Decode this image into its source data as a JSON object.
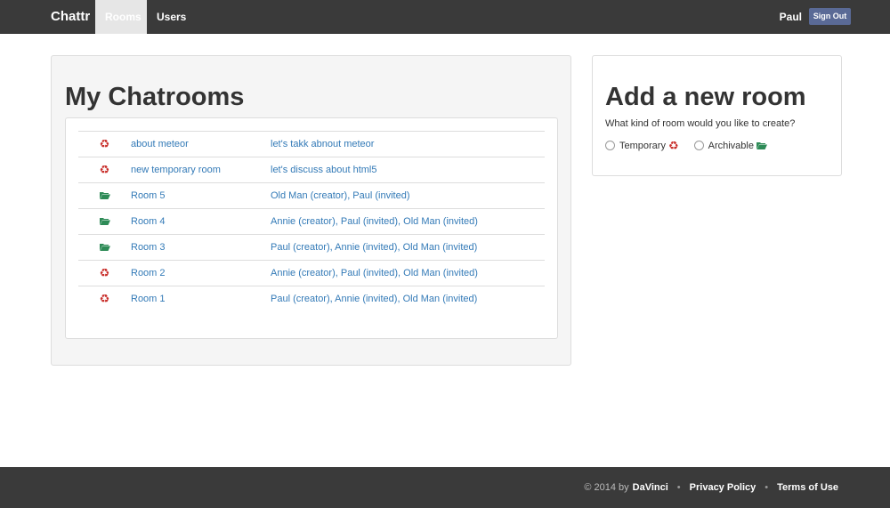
{
  "navbar": {
    "brand": "Chattr",
    "items": [
      {
        "label": "Rooms",
        "active": true
      },
      {
        "label": "Users",
        "active": false
      }
    ],
    "user_name": "Paul",
    "signout_label": "Sign Out"
  },
  "main": {
    "title": "My Chatrooms",
    "rooms": [
      {
        "icon": "recycle-icon",
        "name": "about meteor",
        "description": "let's takk abnout meteor"
      },
      {
        "icon": "recycle-icon",
        "name": "new temporary room",
        "description": "let's discuss about html5"
      },
      {
        "icon": "folder-open-icon",
        "name": "Room 5",
        "description": "Old Man (creator), Paul (invited)"
      },
      {
        "icon": "folder-open-icon",
        "name": "Room 4",
        "description": "Annie (creator), Paul (invited), Old Man (invited)"
      },
      {
        "icon": "folder-open-icon",
        "name": "Room 3",
        "description": "Paul (creator), Annie (invited), Old Man (invited)"
      },
      {
        "icon": "recycle-icon",
        "name": "Room 2",
        "description": "Annie (creator), Paul (invited), Old Man (invited)"
      },
      {
        "icon": "recycle-icon",
        "name": "Room 1",
        "description": "Paul (creator), Annie (invited), Old Man (invited)"
      }
    ]
  },
  "sidebar": {
    "title": "Add a new room",
    "question": "What kind of room would you like to create?",
    "options": [
      {
        "label": "Temporary",
        "icon": "recycle-icon"
      },
      {
        "label": "Archivable",
        "icon": "folder-open-icon"
      }
    ]
  },
  "footer": {
    "copyright": "© 2014 by",
    "author": "DaVinci",
    "separator": "•",
    "links": [
      "Privacy Policy",
      "Terms of Use"
    ]
  },
  "colors": {
    "navbar_bg": "#3a3a3a",
    "link": "#337ab7",
    "recycle_icon": "#c9302c",
    "folder_icon": "#2e8b57",
    "signout_bg": "#5a6a96"
  }
}
